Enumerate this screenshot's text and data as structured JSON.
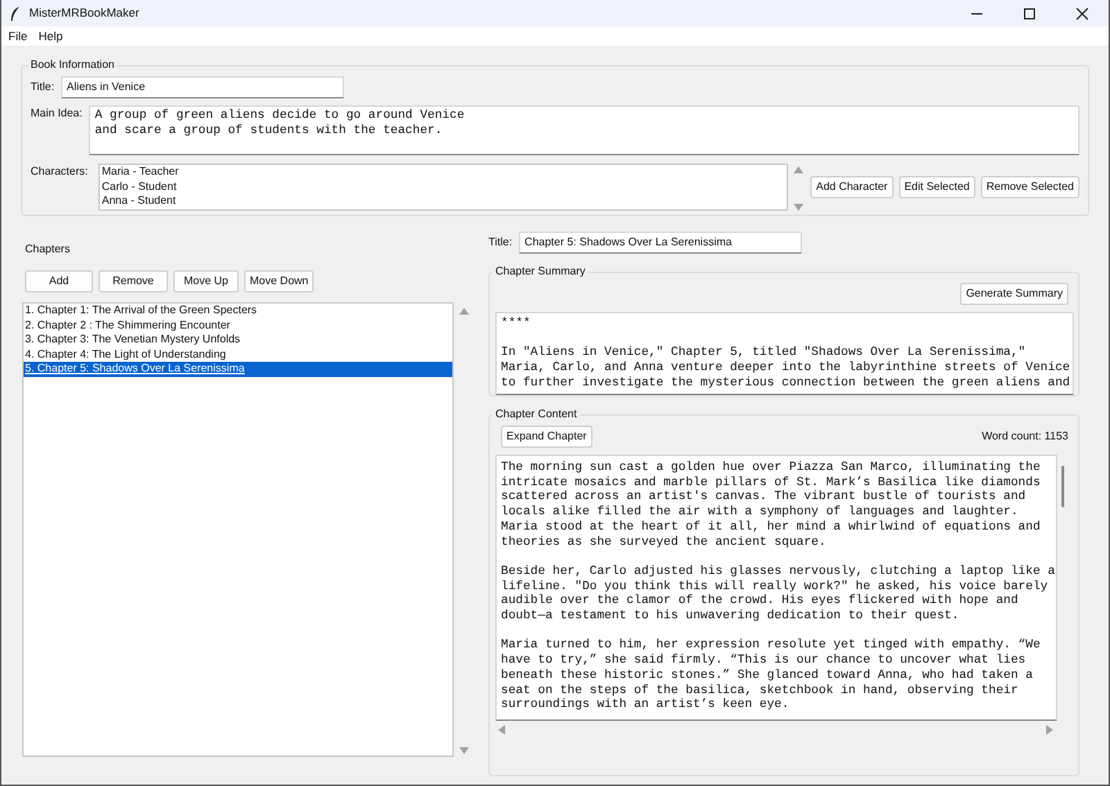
{
  "window": {
    "title": "MisterMRBookMaker"
  },
  "menu": [
    {
      "label": "File"
    },
    {
      "label": "Help"
    }
  ],
  "book_information": {
    "heading": "Book Information",
    "title_label": "Title:",
    "title_value": "Aliens in Venice",
    "main_idea_label": "Main Idea:",
    "main_idea_value": "A group of green aliens decide to go around Venice\nand scare a group of students with the teacher.",
    "characters_label": "Characters:",
    "characters": [
      {
        "name": "Maria - Teacher"
      },
      {
        "name": "Carlo - Student"
      },
      {
        "name": "Anna - Student"
      }
    ],
    "buttons": [
      "Add Character",
      "Edit Selected",
      "Remove Selected"
    ]
  },
  "chapters": {
    "heading": "Chapters",
    "buttons": [
      "Add",
      "Remove",
      "Move Up",
      "Move Down"
    ],
    "items": [
      {
        "label": "1. Chapter 1: The Arrival of the Green Specters",
        "selected": false
      },
      {
        "label": "2. Chapter 2 : The Shimmering Encounter",
        "selected": false
      },
      {
        "label": "3. Chapter 3: The Venetian Mystery Unfolds",
        "selected": false
      },
      {
        "label": "4. Chapter 4: The Light of Understanding",
        "selected": false
      },
      {
        "label": "5. Chapter 5: Shadows Over La Serenissima",
        "selected": true
      }
    ]
  },
  "chapter_editor": {
    "title_label": "Title:",
    "title_value": "Chapter 5: Shadows Over La Serenissima",
    "summary": {
      "heading": "Chapter Summary",
      "button": "Generate Summary",
      "text": "****\n\nIn \"Aliens in Venice,\" Chapter 5, titled \"Shadows Over La Serenissima,\"\nMaria, Carlo, and Anna venture deeper into the labyrinthine streets of Venice\nto further investigate the mysterious connection between the green aliens and"
    },
    "content": {
      "heading": "Chapter Content",
      "button": "Expand Chapter",
      "word_count": "Word count: 1153",
      "text": "The morning sun cast a golden hue over Piazza San Marco, illuminating the\nintricate mosaics and marble pillars of St. Mark’s Basilica like diamonds\nscattered across an artist's canvas. The vibrant bustle of tourists and\nlocals alike filled the air with a symphony of languages and laughter.\nMaria stood at the heart of it all, her mind a whirlwind of equations and\ntheories as she surveyed the ancient square.\n\nBeside her, Carlo adjusted his glasses nervously, clutching a laptop like a\nlifeline. \"Do you think this will really work?\" he asked, his voice barely\naudible over the clamor of the crowd. His eyes flickered with hope and\ndoubt—a testament to his unwavering dedication to their quest.\n\nMaria turned to him, her expression resolute yet tinged with empathy. “We\nhave to try,” she said firmly. “This is our chance to uncover what lies\nbeneath these historic stones.” She glanced toward Anna, who had taken a\nseat on the steps of the basilica, sketchbook in hand, observing their\nsurroundings with an artist’s keen eye."
    }
  }
}
